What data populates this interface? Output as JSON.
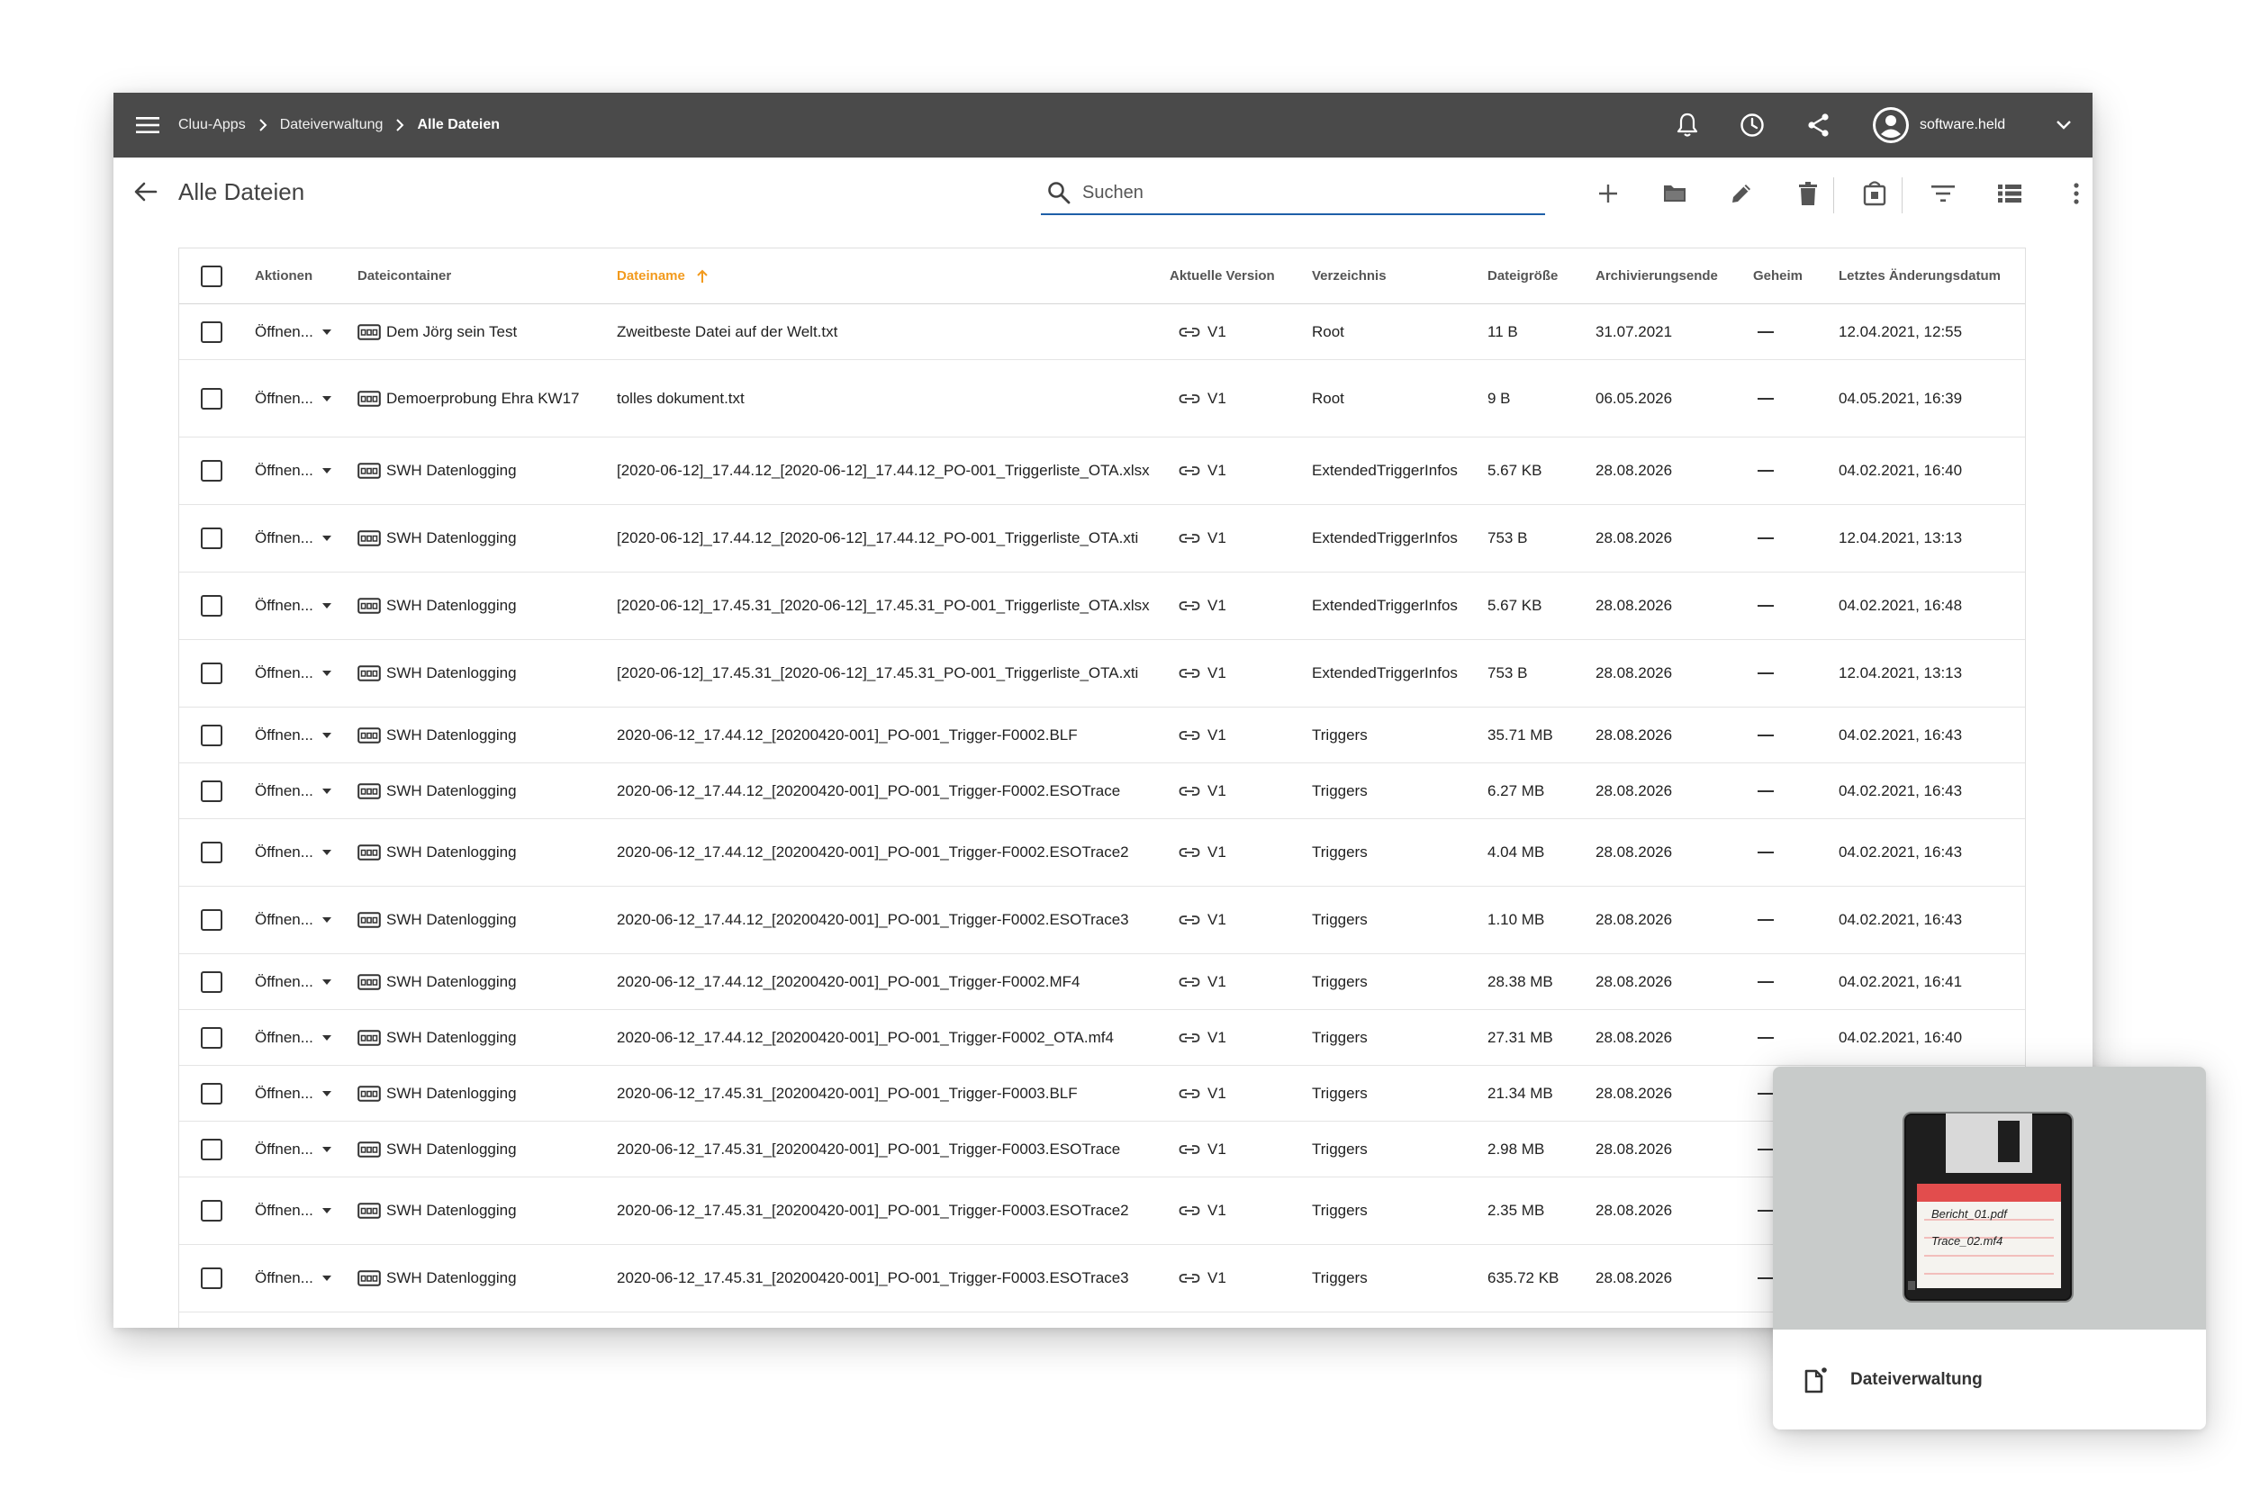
{
  "topbar": {
    "breadcrumbs": [
      "Cluu-Apps",
      "Dateiverwaltung",
      "Alle Dateien"
    ],
    "user_name": "software.held"
  },
  "page": {
    "title": "Alle Dateien",
    "search_placeholder": "Suchen"
  },
  "table": {
    "columns": {
      "actions": "Aktionen",
      "container": "Dateicontainer",
      "name": "Dateiname",
      "version": "Aktuelle Version",
      "directory": "Verzeichnis",
      "size": "Dateigröße",
      "archive_end": "Archivierungsende",
      "secret": "Geheim",
      "modified": "Letztes Änderungsdatum"
    },
    "sorted_column": "Dateiname",
    "rows": [
      {
        "action": "Öffnen...",
        "container": "Dem Jörg sein Test",
        "name": "Zweitbeste Datei auf der Welt.txt",
        "version": "V1",
        "directory": "Root",
        "size": "11 B",
        "archive_end": "31.07.2021",
        "modified": "12.04.2021, 12:55"
      },
      {
        "action": "Öffnen...",
        "container": "Demoerprobung Ehra KW17",
        "name": "tolles dokument.txt",
        "version": "V1",
        "directory": "Root",
        "size": "9 B",
        "archive_end": "06.05.2026",
        "modified": "04.05.2021, 16:39"
      },
      {
        "action": "Öffnen...",
        "container": "SWH Datenlogging",
        "name": "[2020-06-12]_17.44.12_[2020-06-12]_17.44.12_PO-001_Triggerliste_OTA.xlsx",
        "version": "V1",
        "directory": "ExtendedTriggerInfos",
        "size": "5.67 KB",
        "archive_end": "28.08.2026",
        "modified": "04.02.2021, 16:40"
      },
      {
        "action": "Öffnen...",
        "container": "SWH Datenlogging",
        "name": "[2020-06-12]_17.44.12_[2020-06-12]_17.44.12_PO-001_Triggerliste_OTA.xti",
        "version": "V1",
        "directory": "ExtendedTriggerInfos",
        "size": "753 B",
        "archive_end": "28.08.2026",
        "modified": "12.04.2021, 13:13"
      },
      {
        "action": "Öffnen...",
        "container": "SWH Datenlogging",
        "name": "[2020-06-12]_17.45.31_[2020-06-12]_17.45.31_PO-001_Triggerliste_OTA.xlsx",
        "version": "V1",
        "directory": "ExtendedTriggerInfos",
        "size": "5.67 KB",
        "archive_end": "28.08.2026",
        "modified": "04.02.2021, 16:48"
      },
      {
        "action": "Öffnen...",
        "container": "SWH Datenlogging",
        "name": "[2020-06-12]_17.45.31_[2020-06-12]_17.45.31_PO-001_Triggerliste_OTA.xti",
        "version": "V1",
        "directory": "ExtendedTriggerInfos",
        "size": "753 B",
        "archive_end": "28.08.2026",
        "modified": "12.04.2021, 13:13"
      },
      {
        "action": "Öffnen...",
        "container": "SWH Datenlogging",
        "name": "2020-06-12_17.44.12_[20200420-001]_PO-001_Trigger-F0002.BLF",
        "version": "V1",
        "directory": "Triggers",
        "size": "35.71 MB",
        "archive_end": "28.08.2026",
        "modified": "04.02.2021, 16:43"
      },
      {
        "action": "Öffnen...",
        "container": "SWH Datenlogging",
        "name": "2020-06-12_17.44.12_[20200420-001]_PO-001_Trigger-F0002.ESOTrace",
        "version": "V1",
        "directory": "Triggers",
        "size": "6.27 MB",
        "archive_end": "28.08.2026",
        "modified": "04.02.2021, 16:43"
      },
      {
        "action": "Öffnen...",
        "container": "SWH Datenlogging",
        "name": "2020-06-12_17.44.12_[20200420-001]_PO-001_Trigger-F0002.ESOTrace2",
        "version": "V1",
        "directory": "Triggers",
        "size": "4.04 MB",
        "archive_end": "28.08.2026",
        "modified": "04.02.2021, 16:43"
      },
      {
        "action": "Öffnen...",
        "container": "SWH Datenlogging",
        "name": "2020-06-12_17.44.12_[20200420-001]_PO-001_Trigger-F0002.ESOTrace3",
        "version": "V1",
        "directory": "Triggers",
        "size": "1.10 MB",
        "archive_end": "28.08.2026",
        "modified": "04.02.2021, 16:43"
      },
      {
        "action": "Öffnen...",
        "container": "SWH Datenlogging",
        "name": "2020-06-12_17.44.12_[20200420-001]_PO-001_Trigger-F0002.MF4",
        "version": "V1",
        "directory": "Triggers",
        "size": "28.38 MB",
        "archive_end": "28.08.2026",
        "modified": "04.02.2021, 16:41"
      },
      {
        "action": "Öffnen...",
        "container": "SWH Datenlogging",
        "name": "2020-06-12_17.44.12_[20200420-001]_PO-001_Trigger-F0002_OTA.mf4",
        "version": "V1",
        "directory": "Triggers",
        "size": "27.31 MB",
        "archive_end": "28.08.2026",
        "modified": "04.02.2021, 16:40"
      },
      {
        "action": "Öffnen...",
        "container": "SWH Datenlogging",
        "name": "2020-06-12_17.45.31_[20200420-001]_PO-001_Trigger-F0003.BLF",
        "version": "V1",
        "directory": "Triggers",
        "size": "21.34 MB",
        "archive_end": "28.08.2026",
        "modified": ""
      },
      {
        "action": "Öffnen...",
        "container": "SWH Datenlogging",
        "name": "2020-06-12_17.45.31_[20200420-001]_PO-001_Trigger-F0003.ESOTrace",
        "version": "V1",
        "directory": "Triggers",
        "size": "2.98 MB",
        "archive_end": "28.08.2026",
        "modified": ""
      },
      {
        "action": "Öffnen...",
        "container": "SWH Datenlogging",
        "name": "2020-06-12_17.45.31_[20200420-001]_PO-001_Trigger-F0003.ESOTrace2",
        "version": "V1",
        "directory": "Triggers",
        "size": "2.35 MB",
        "archive_end": "28.08.2026",
        "modified": ""
      },
      {
        "action": "Öffnen...",
        "container": "SWH Datenlogging",
        "name": "2020-06-12_17.45.31_[20200420-001]_PO-001_Trigger-F0003.ESOTrace3",
        "version": "V1",
        "directory": "Triggers",
        "size": "635.72 KB",
        "archive_end": "28.08.2026",
        "modified": ""
      }
    ]
  },
  "card": {
    "label": "Dateiverwaltung",
    "disk_label_line1": "Bericht_01.pdf",
    "disk_label_line2": "Trace_02.mf4"
  },
  "icons": {
    "menu": "menu-icon",
    "bell": "bell-icon",
    "history": "clock-icon",
    "share": "share-icon",
    "account": "account-icon",
    "back": "arrow-back-icon",
    "search": "search-icon",
    "add": "plus-icon",
    "folder": "folder-icon",
    "edit": "pencil-icon",
    "delete": "trash-icon",
    "archive": "lock-box-icon",
    "filter": "filter-icon",
    "view": "list-view-icon",
    "more": "more-vert-icon"
  },
  "colors": {
    "topbar": "#4a4a4a",
    "accent_sort": "#f29a1d",
    "search_underline": "#1e5fa8",
    "card_image": "#c8cbca"
  }
}
